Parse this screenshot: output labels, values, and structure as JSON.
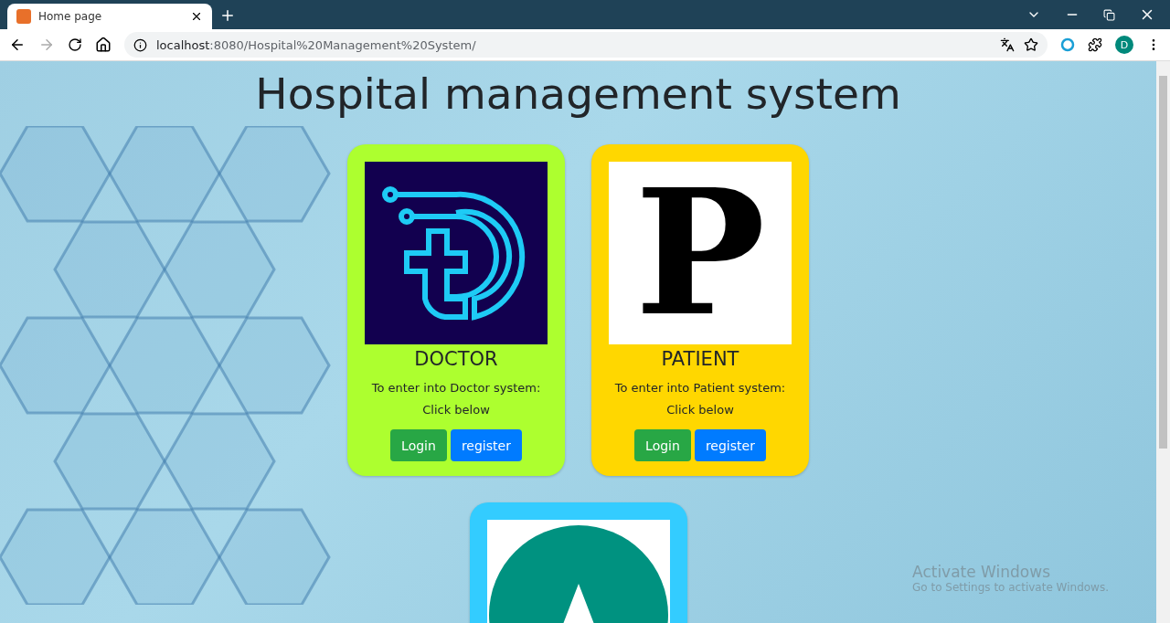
{
  "browser": {
    "tab": {
      "title": "Home page",
      "selected": true
    },
    "address_host": "localhost",
    "address_path": ":8080/Hospital%20Management%20System/",
    "profile_initial": "D"
  },
  "page": {
    "title": "Hospital management system",
    "cards": [
      {
        "kind": "doctor",
        "color": "#adff2f",
        "name": "DOCTOR",
        "description": "To enter into Doctor system: Click below",
        "buttons": [
          {
            "label": "Login",
            "kind": "login"
          },
          {
            "label": "register",
            "kind": "register"
          }
        ]
      },
      {
        "kind": "patient",
        "color": "#ffd700",
        "logo_letter": "P",
        "name": "PATIENT",
        "description": "To enter into Patient system: Click below",
        "buttons": [
          {
            "label": "Login",
            "kind": "login"
          },
          {
            "label": "register",
            "kind": "register"
          }
        ]
      },
      {
        "kind": "admin",
        "color": "#33ccff"
      }
    ]
  },
  "os_notice": {
    "title": "Activate Windows",
    "text": "Go to Settings to activate Windows."
  }
}
